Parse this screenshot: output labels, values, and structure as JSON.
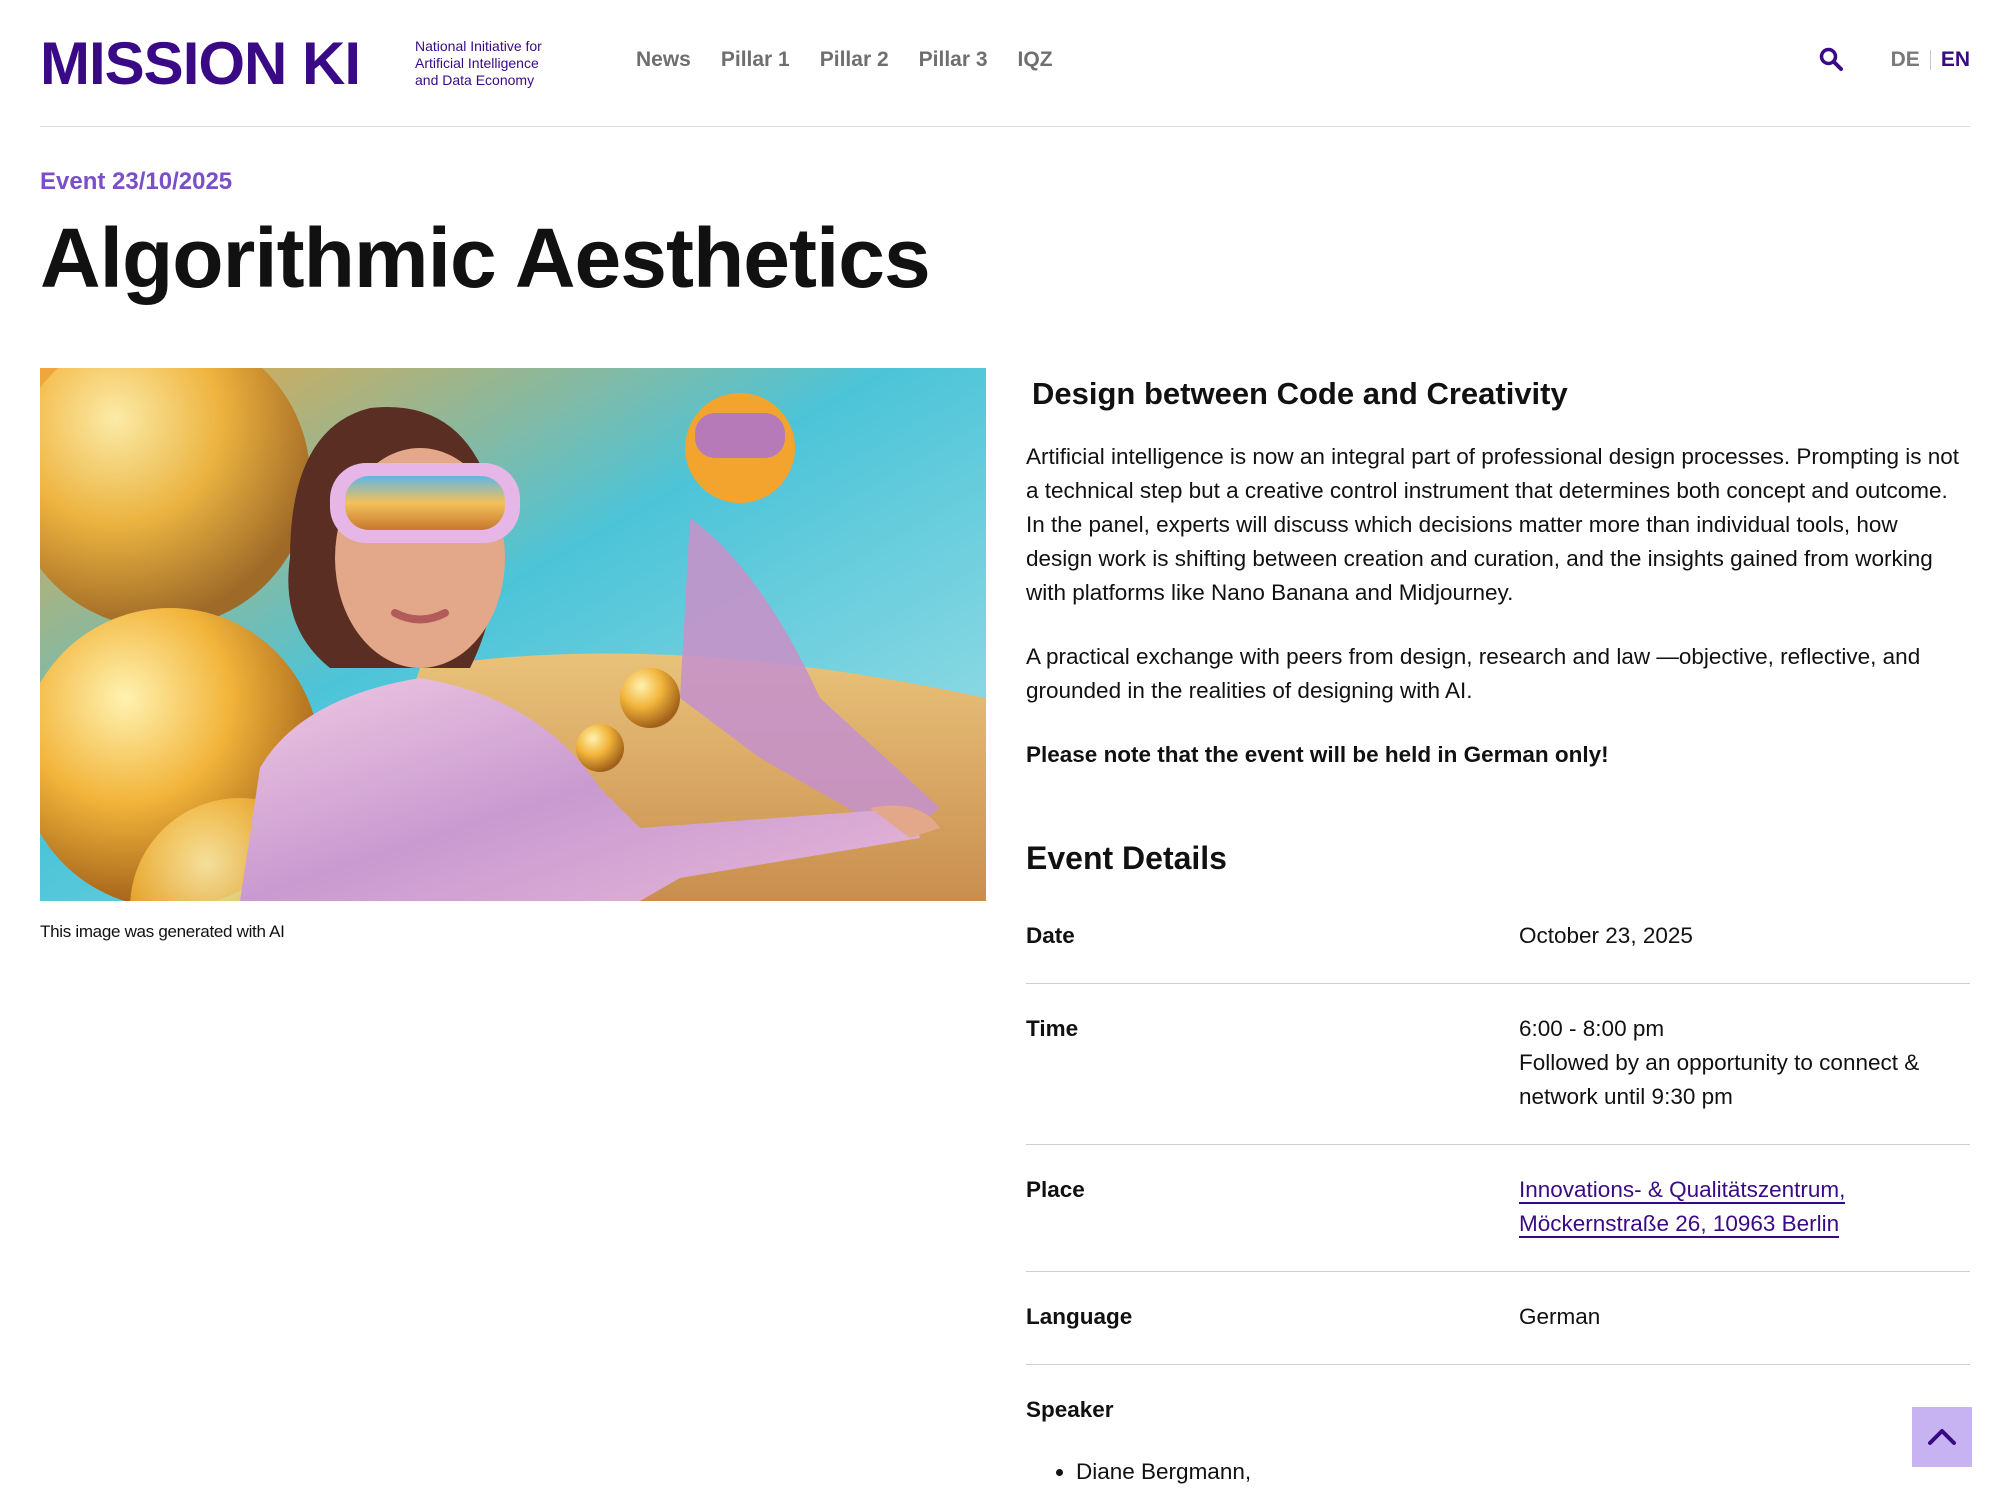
{
  "header": {
    "logo": "MISSION KI",
    "tagline": "National Initiative for\nArtificial Intelligence\nand Data Economy",
    "nav": [
      "News",
      "Pillar 1",
      "Pillar 2",
      "Pillar 3",
      "IQZ"
    ],
    "search_icon": "search-icon",
    "lang": {
      "de": "DE",
      "en": "EN"
    }
  },
  "event": {
    "kicker": "Event 23/10/2025",
    "title": "Algorithmic Aesthetics",
    "image_caption": "This image was generated with AI",
    "subtitle": "Design between  Code and Creativity",
    "paragraphs": [
      "Artificial intelligence is now an integral part of professional design processes. Prompting is not a technical step but a creative control instrument that determines both concept and outcome. In the panel, experts will discuss which decisions matter more than individual tools, how design work is shifting between creation and curation, and the insights gained from working with platforms like Nano Banana and Midjourney.",
      "A practical exchange with peers from design, research and law —objective, reflective, and grounded in the realities of designing with AI."
    ],
    "note": "Please note that the event will be held in German only!"
  },
  "details": {
    "title": "Event Details",
    "date_label": "Date",
    "date_value": "October 23, 2025",
    "time_label": "Time",
    "time_value": "6:00 - 8:00 pm",
    "time_extra": "Followed by an opportunity to connect & network until 9:30 pm",
    "place_label": "Place",
    "place_line1": "Innovations- & Qualitätszentrum,",
    "place_line2": "Möckernstraße 26, 10963 Berlin",
    "language_label": "Language",
    "language_value": "German",
    "speaker_label": "Speaker",
    "speakers": [
      "Diane Bergmann,"
    ]
  },
  "colors": {
    "brand": "#3a0a86",
    "accent": "#7a4fc7",
    "back_to_top": "#c8b3f2"
  },
  "back_to_top_icon": "chevron-up-icon"
}
